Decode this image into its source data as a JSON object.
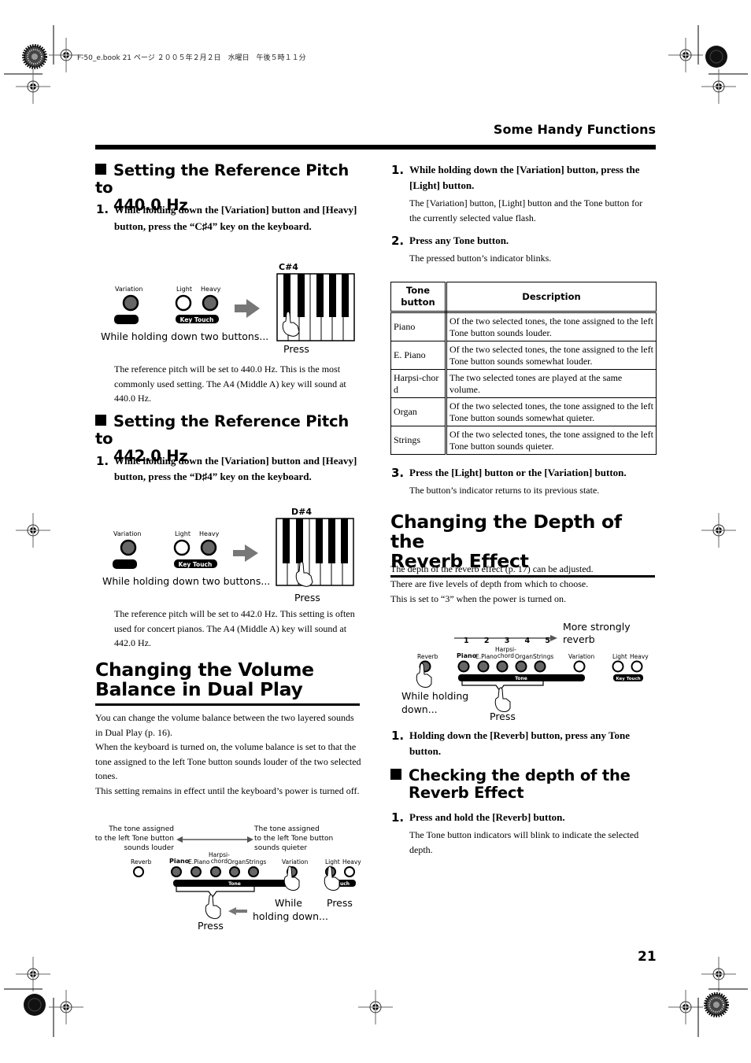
{
  "print_header": "F-50_e.book  21 ページ  ２００５年２月２日　水曜日　午後５時１１分",
  "section_label": "Some Handy Functions",
  "page_number": "21",
  "left": {
    "s1": {
      "title_line1": "Setting the Reference Pitch to",
      "title_line2": "440.0 Hz",
      "step_num": "1.",
      "step_text": "While holding down the [Variation] button and [Heavy] button, press the “C♯4” key on the keyboard.",
      "diagram": {
        "key_label": "C#4",
        "variation": "Variation",
        "light": "Light",
        "heavy": "Heavy",
        "key_touch": "Key Touch",
        "holding": "While holding down two buttons...",
        "press": "Press"
      },
      "body": "The reference pitch will be set to 440.0 Hz. This is the most commonly used setting. The A4 (Middle A) key will sound at 440.0 Hz."
    },
    "s2": {
      "title_line1": "Setting the Reference Pitch to",
      "title_line2": "442.0 Hz",
      "step_num": "1.",
      "step_text": "While holding down the [Variation] button and [Heavy] button, press the “D♯4” key on the keyboard.",
      "diagram": {
        "key_label": "D#4",
        "variation": "Variation",
        "light": "Light",
        "heavy": "Heavy",
        "key_touch": "Key Touch",
        "holding": "While holding down two buttons...",
        "press": "Press"
      },
      "body": "The reference pitch will be set to 442.0 Hz. This setting is often used for concert pianos. The A4 (Middle A) key will sound at 442.0 Hz."
    },
    "s3": {
      "title_line1": "Changing the Volume",
      "title_line2": "Balance in Dual Play",
      "body1": "You can change the volume balance between the two layered sounds in Dual Play (p. 16).",
      "body2": "When the keyboard is turned on, the volume balance is set to that the tone assigned to the left Tone button sounds louder of the two selected tones.",
      "body3": "This setting remains in effect until the keyboard’s power is turned off.",
      "diagram": {
        "louder_1": "The tone assigned",
        "louder_2": "to the left Tone button",
        "louder_3": "sounds louder",
        "quieter_1": "The tone assigned",
        "quieter_2": "to the left Tone button",
        "quieter_3": "sounds quieter",
        "reverb": "Reverb",
        "piano": "Piano",
        "epiano": "E.Piano",
        "harpsi_1": "Harpsi-",
        "harpsi_2": "chord",
        "organ": "Organ",
        "strings": "Strings",
        "variation": "Variation",
        "light": "Light",
        "heavy": "Heavy",
        "tone": "Tone",
        "touch": "uch",
        "press_left": "Press",
        "while_1": "While",
        "while_2": "holding down...",
        "press_right": "Press"
      }
    }
  },
  "right": {
    "step1_num": "1.",
    "step1": "While holding down the [Variation] button, press the [Light] button.",
    "step1_body": "The [Variation] button, [Light] button and the Tone button for the currently selected value flash.",
    "step2_num": "2.",
    "step2": "Press any Tone button.",
    "step2_body": "The pressed button’s indicator blinks.",
    "table": {
      "headers": [
        "Tone button",
        "Description"
      ],
      "rows": [
        {
          "tone": "Piano",
          "desc": "Of the two selected tones, the tone assigned to the left Tone button sounds louder."
        },
        {
          "tone": "E. Piano",
          "desc": "Of the two selected tones, the tone assigned to the left Tone button sounds somewhat louder."
        },
        {
          "tone": "Harpsi-chord",
          "desc": "The two selected tones are played at the same volume."
        },
        {
          "tone": "Organ",
          "desc": "Of the two selected tones, the tone assigned to the left Tone button sounds somewhat quieter."
        },
        {
          "tone": "Strings",
          "desc": "Of the two selected tones, the tone assigned to the left Tone button sounds quieter."
        }
      ]
    },
    "step3_num": "3.",
    "step3": "Press the [Light] button or the [Variation] button.",
    "step3_body": "The button’s indicator returns to its previous state.",
    "s4": {
      "title_line1": "Changing the Depth of the",
      "title_line2": "Reverb Effect",
      "body1": "The depth of the reverb effect (p. 17) can be adjusted.",
      "body2": "There are five levels of depth from which to choose.",
      "body3": "This is set to “3” when the power is turned on.",
      "diagram": {
        "levels": [
          "1",
          "2",
          "3",
          "4",
          "5"
        ],
        "more_1": "More strongly",
        "more_2": "reverb",
        "reverb": "Reverb",
        "piano": "Piano",
        "epiano": "E.Piano",
        "harpsi_1": "Harpsi-",
        "harpsi_2": "chord",
        "organ": "Organ",
        "strings": "Strings",
        "variation": "Variation",
        "light": "Light",
        "heavy": "Heavy",
        "tone": "Tone",
        "key_touch": "Key Touch",
        "holding_1": "While holding",
        "holding_2": "down...",
        "press": "Press"
      },
      "step_num": "1.",
      "step": "Holding down the [Reverb] button, press any Tone button."
    },
    "s5": {
      "title_line1": "Checking the depth of the",
      "title_line2": "Reverb Effect",
      "step_num": "1.",
      "step": "Press and hold the [Reverb] button.",
      "body": "The Tone button indicators will blink to indicate the selected depth."
    }
  }
}
